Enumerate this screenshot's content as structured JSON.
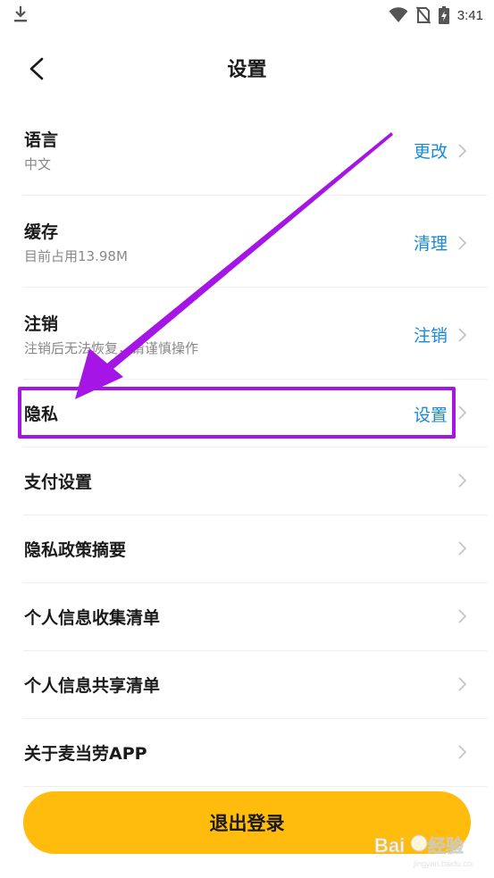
{
  "status_bar": {
    "time": "3:41"
  },
  "header": {
    "title": "设置"
  },
  "settings": {
    "language": {
      "title": "语言",
      "subtitle": "中文",
      "action": "更改"
    },
    "cache": {
      "title": "缓存",
      "subtitle": "目前占用13.98M",
      "action": "清理"
    },
    "deregister": {
      "title": "注销",
      "subtitle": "注销后无法恢复，请谨慎操作",
      "action": "注销"
    },
    "privacy": {
      "title": "隐私",
      "action": "设置"
    },
    "payment": {
      "title": "支付设置"
    },
    "privacy_policy": {
      "title": "隐私政策摘要"
    },
    "info_collection": {
      "title": "个人信息收集清单"
    },
    "info_sharing": {
      "title": "个人信息共享清单"
    },
    "about": {
      "title": "关于麦当劳APP"
    }
  },
  "footer": {
    "logout_label": "退出登录"
  },
  "colors": {
    "accent_blue": "#1a8ad8",
    "logout_yellow": "#ffbc0d",
    "annotation_purple": "#a415e6"
  },
  "watermark": {
    "text": "Bai经验"
  }
}
